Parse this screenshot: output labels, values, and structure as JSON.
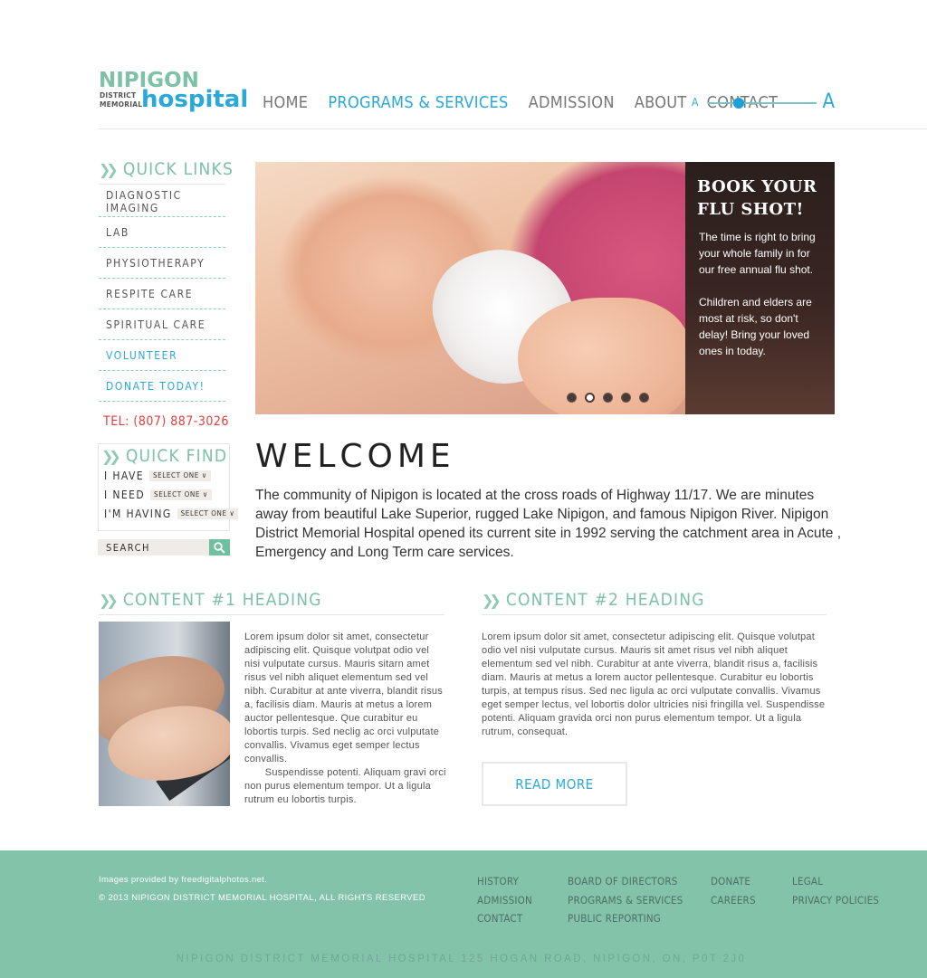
{
  "logo": {
    "line1": "NIPIGON",
    "district": "DISTRICT",
    "memorial": "MEMORIAL",
    "hospital": "hospital"
  },
  "nav": {
    "items": [
      "HOME",
      "PROGRAMS & SERVICES",
      "ADMISSION",
      "ABOUT",
      "CONTACT"
    ],
    "active_index": 1
  },
  "font_size_control": {
    "small_label": "A",
    "large_label": "A",
    "level": 0.25
  },
  "sidebar": {
    "quick_links_title": "QUICK LINKS",
    "quick_links": [
      "DIAGNOSTIC IMAGING",
      "LAB",
      "PHYSIOTHERAPY",
      "RESPITE CARE",
      "SPIRITUAL CARE",
      "VOLUNTEER",
      "DONATE TODAY!"
    ],
    "telephone": "TEL: (807) 887-3026",
    "quick_find_title": "QUICK FIND",
    "quick_find": [
      {
        "label": "I HAVE",
        "select": "SELECT ONE"
      },
      {
        "label": "I NEED",
        "select": "SELECT ONE"
      },
      {
        "label": "I'M HAVING",
        "select": "SELECT ONE"
      }
    ],
    "search_placeholder": "SEARCH"
  },
  "hero": {
    "title": "BOOK YOUR FLU SHOT!",
    "para1": "The time is right to bring your whole family in for our free annual flu shot.",
    "para2": "Children and elders are most at risk, so don't delay! Bring your loved ones in today.",
    "slide_count": 5,
    "active_slide": 1
  },
  "welcome": {
    "title": "WELCOME",
    "text": "The community of Nipigon is located at the cross roads of Highway 11/17.  We are minutes away from beautiful Lake Superior, rugged Lake Nipigon, and famous Nipigon River. Nipigon District Memorial Hospital opened its current site in 1992 serving the catchment area in Acute , Emergency and Long Term care services."
  },
  "content1": {
    "heading": "CONTENT #1 HEADING",
    "text": "Lorem ipsum dolor sit amet, consectetur adipiscing elit. Quisque volutpat odio vel nisi vulputate cursus. Mauris sitarn amet risus vel nibh aliquet elementum sed vel nibh. Curabitur at ante viverra, blandit risus a, facilisis diam. Mauris at metus a lorem auctor pellentesque. Que curabitur eu lobortis turpis. Sed neclig ac orci vulputate convallis. Vivamus eget semper lectus convallis.",
    "text2": "Suspendisse potenti. Aliquam gravi orci non purus elementum tempor. Ut a ligula rutrum eu lobortis turpis."
  },
  "content2": {
    "heading": "CONTENT #2 HEADING",
    "text": "Lorem ipsum dolor sit amet, consectetur adipiscing elit. Quisque volutpat odio vel nisi vulputate cursus. Mauris sit amet risus vel nibh aliquet elementum sed vel nibh. Curabitur at ante viverra, blandit risus a, facilisis diam. Mauris at metus a lorem auctor pellentesque. Curabitur eu lobortis turpis, at tempus risus. Sed nec ligula ac orci vulputate convallis. Vivamus eget semper lectus, vel lobortis dolor ultricies nisi fringilla vel. Suspendisse potenti. Aliquam gravida orci non purus elementum tempor. Ut a ligula rutrum, consequat.",
    "read_more": "READ MORE"
  },
  "footer": {
    "credit": "Images provided by freedigitalphotos.net.",
    "copyright": "© 2013 NIPIGON DISTRICT MEMORIAL HOSPITAL, ALL RIGHTS RESERVED",
    "col1": [
      "HISTORY",
      "ADMISSION",
      "CONTACT"
    ],
    "col2": [
      "BOARD OF DIRECTORS",
      "PROGRAMS & SERVICES",
      "PUBLIC REPORTING"
    ],
    "col3": [
      "DONATE",
      "CAREERS"
    ],
    "col4": [
      "LEGAL",
      "PRIVACY POLICIES"
    ],
    "address": "NIPIGON DISTRICT MEMORIAL HOSPITAL 125 HOGAN ROAD, NIPIGON, ON,  P0T 2J0"
  },
  "colors": {
    "brand_teal": "#7cc1a8",
    "brand_blue": "#2aa8d8",
    "footer_bg": "#82c3aa",
    "alert_red": "#e23b3b"
  },
  "icons": {
    "section_marker": "double-chevron-right-icon",
    "search": "search-icon"
  }
}
